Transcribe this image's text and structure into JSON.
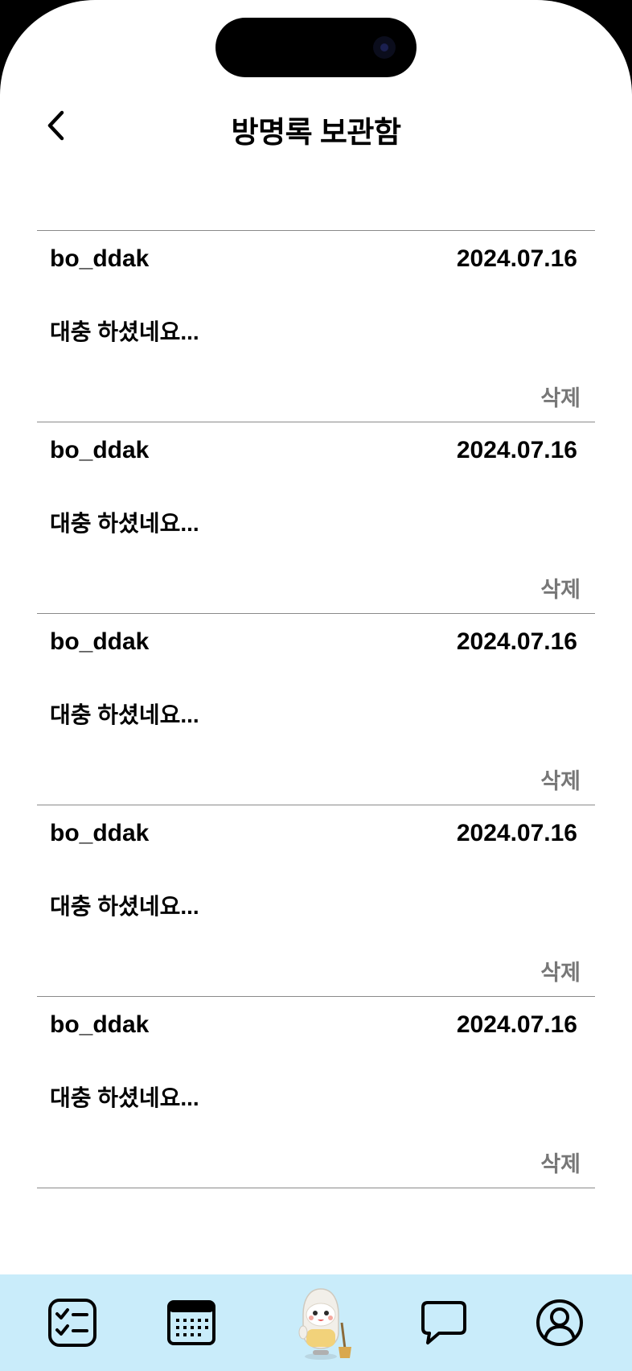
{
  "header": {
    "title": "방명록 보관함",
    "back_icon": "chevron-left-icon"
  },
  "entries": [
    {
      "author": "bo_ddak",
      "date": "2024.07.16",
      "content": "대충 하셨네요...",
      "delete_label": "삭제"
    },
    {
      "author": "bo_ddak",
      "date": "2024.07.16",
      "content": "대충 하셨네요...",
      "delete_label": "삭제"
    },
    {
      "author": "bo_ddak",
      "date": "2024.07.16",
      "content": "대충 하셨네요...",
      "delete_label": "삭제"
    },
    {
      "author": "bo_ddak",
      "date": "2024.07.16",
      "content": "대충 하셨네요...",
      "delete_label": "삭제"
    },
    {
      "author": "bo_ddak",
      "date": "2024.07.16",
      "content": "대충 하셨네요...",
      "delete_label": "삭제"
    }
  ],
  "tabbar": {
    "background": "#c9ecfa",
    "tabs": [
      {
        "icon": "checklist-icon"
      },
      {
        "icon": "calendar-icon"
      },
      {
        "icon": "character-mascot-icon"
      },
      {
        "icon": "chat-bubble-icon"
      },
      {
        "icon": "profile-icon"
      }
    ]
  }
}
